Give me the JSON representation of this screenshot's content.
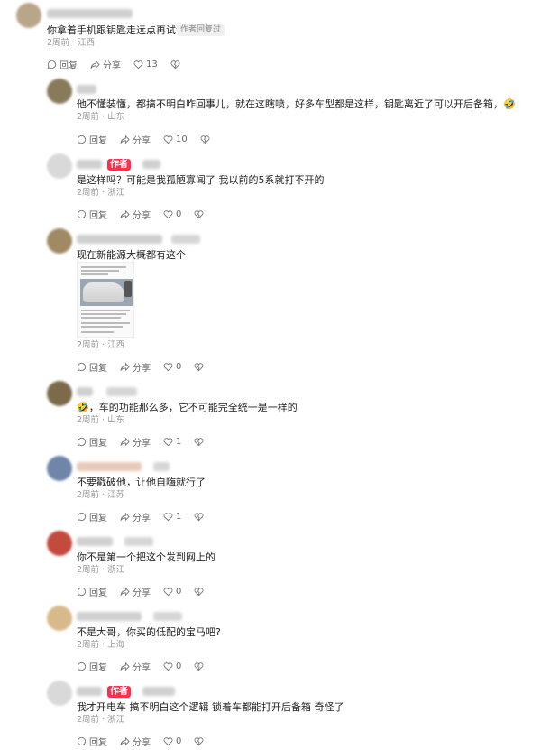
{
  "actions": {
    "reply": "回复",
    "share": "分享"
  },
  "comments": [
    {
      "text": "你拿着手机跟钥匙走远点再试试",
      "time": "2周前",
      "location": "江西",
      "likes": "13",
      "badge": "作者回复过"
    },
    {
      "text": "他不懂装懂，都搞不明白咋回事儿，就在这瞎喷，好多车型都是这样，钥匙离近了可以开后备箱，",
      "time": "2周前",
      "location": "山东",
      "likes": "10"
    },
    {
      "text": "是这样吗？可能是我孤陋寡闻了 我以前的5系就打不开的",
      "time": "2周前",
      "location": "浙江",
      "likes": "0",
      "badge": "作者"
    },
    {
      "text": "现在新能源大概都有这个",
      "time": "2周前",
      "location": "江西",
      "likes": "0"
    },
    {
      "text": "，车的功能那么多，它不可能完全统一是一样的",
      "time": "2周前",
      "location": "山东",
      "likes": "1"
    },
    {
      "text": "不要戳破他，让他自嗨就行了",
      "time": "2周前",
      "location": "江苏",
      "likes": "1"
    },
    {
      "text": "你不是第一个把这个发到网上的",
      "time": "2周前",
      "location": "浙江",
      "likes": "0"
    },
    {
      "text": "不是大哥，你买的低配的宝马吧?",
      "time": "2周前",
      "location": "上海",
      "likes": "0"
    },
    {
      "text": "我才开电车  搞不明白这个逻辑  锁着车都能打开后备箱  奇怪了",
      "time": "2周前",
      "location": "浙江",
      "likes": "0",
      "badge": "作者"
    }
  ],
  "colors": {
    "accent": "#ff2e4d"
  }
}
